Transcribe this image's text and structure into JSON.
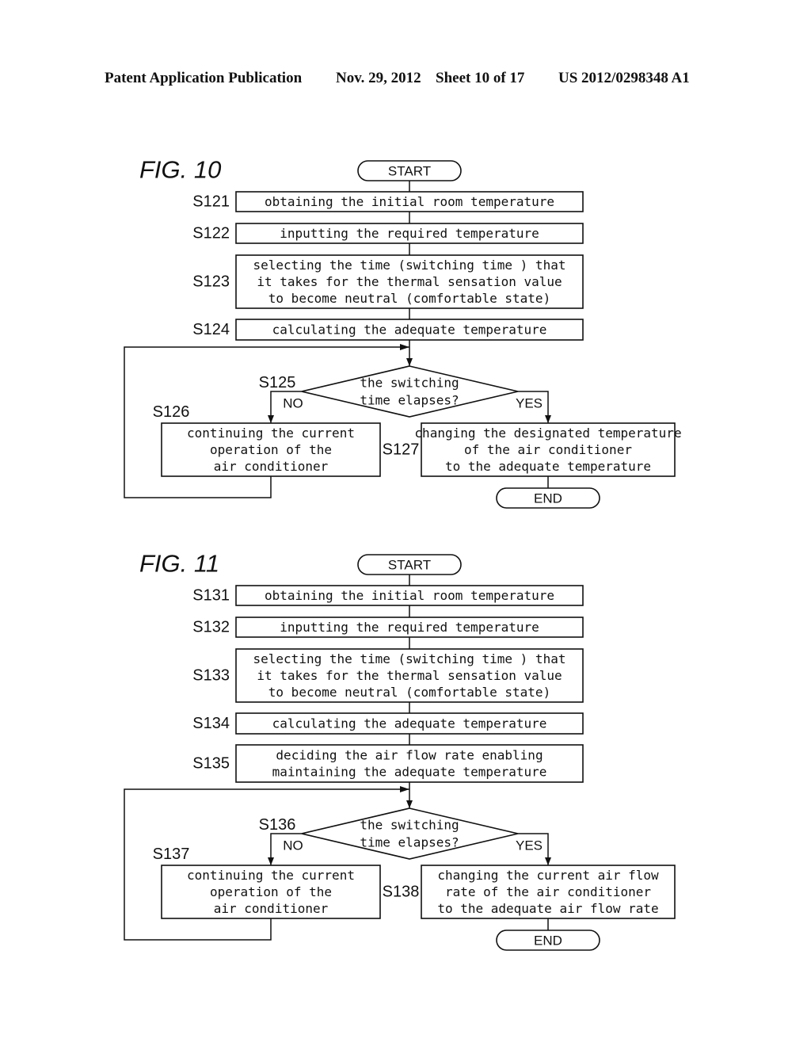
{
  "header": {
    "publication": "Patent Application Publication",
    "date": "Nov. 29, 2012",
    "sheet": "Sheet 10 of 17",
    "patent_number": "US 2012/0298348 A1"
  },
  "figures": [
    {
      "title": "FIG. 10",
      "start_label": "START",
      "end_label": "END",
      "steps": [
        {
          "id": "S121",
          "lines": [
            "obtaining the initial room temperature"
          ]
        },
        {
          "id": "S122",
          "lines": [
            "inputting the required temperature"
          ]
        },
        {
          "id": "S123",
          "lines": [
            "selecting the time (switching time ) that",
            "it takes for the thermal sensation value",
            "to become neutral (comfortable state)"
          ]
        },
        {
          "id": "S124",
          "lines": [
            "calculating the adequate temperature"
          ]
        }
      ],
      "decision": {
        "id": "S125",
        "lines": [
          "the switching",
          "time elapses?"
        ],
        "no_label": "NO",
        "yes_label": "YES"
      },
      "no_step": {
        "id": "S126",
        "lines": [
          "continuing the current",
          "operation of the",
          "air conditioner"
        ]
      },
      "yes_step": {
        "id": "S127",
        "lines": [
          "changing the designated temperature",
          "of the air conditioner",
          "to the adequate temperature"
        ]
      }
    },
    {
      "title": "FIG. 11",
      "start_label": "START",
      "end_label": "END",
      "steps": [
        {
          "id": "S131",
          "lines": [
            "obtaining the initial room temperature"
          ]
        },
        {
          "id": "S132",
          "lines": [
            "inputting the required temperature"
          ]
        },
        {
          "id": "S133",
          "lines": [
            "selecting the time (switching time ) that",
            "it takes for the thermal sensation value",
            "to become neutral (comfortable state)"
          ]
        },
        {
          "id": "S134",
          "lines": [
            "calculating the adequate temperature"
          ]
        },
        {
          "id": "S135",
          "lines": [
            "deciding the air flow rate enabling",
            "maintaining the adequate temperature"
          ]
        }
      ],
      "decision": {
        "id": "S136",
        "lines": [
          "the switching",
          "time elapses?"
        ],
        "no_label": "NO",
        "yes_label": "YES"
      },
      "no_step": {
        "id": "S137",
        "lines": [
          "continuing the current",
          "operation of the",
          "air conditioner"
        ]
      },
      "yes_step": {
        "id": "S138",
        "lines": [
          "changing the current air flow",
          "rate of the air conditioner",
          "to the adequate air flow rate"
        ]
      }
    }
  ]
}
